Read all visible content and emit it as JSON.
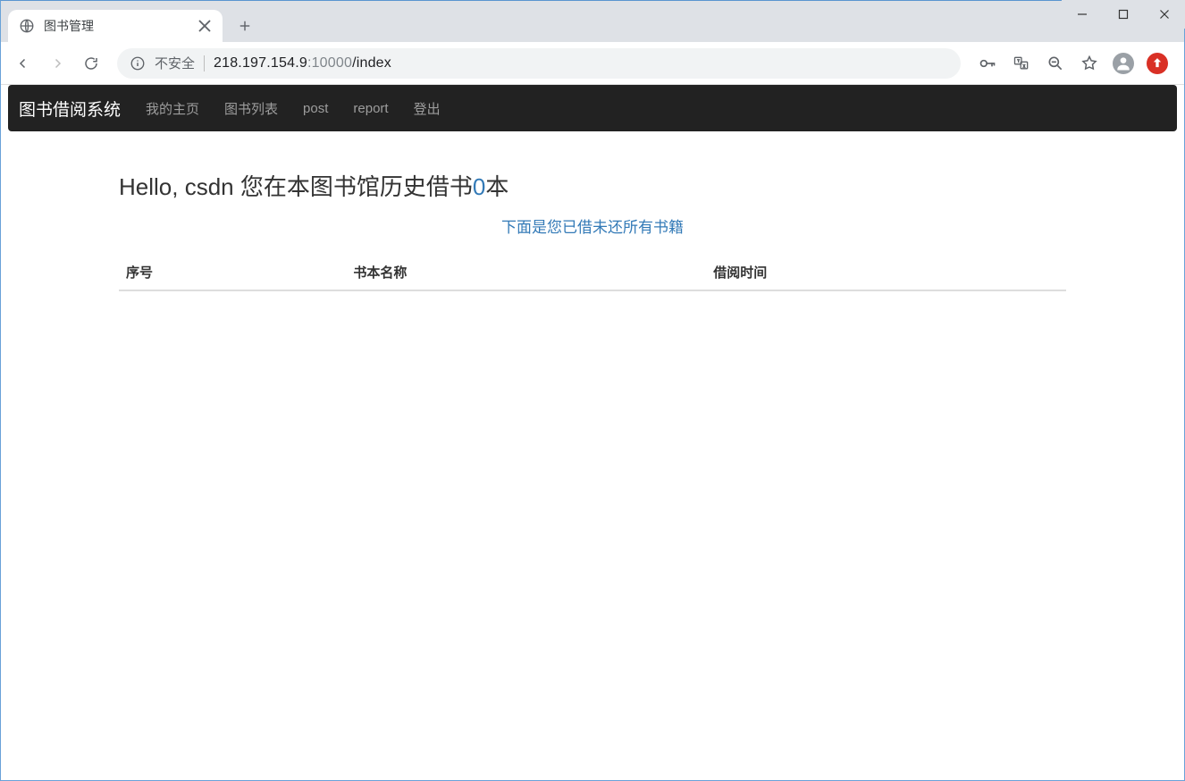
{
  "tab": {
    "title": "图书管理"
  },
  "address": {
    "insecure_label": "不安全",
    "host": "218.197.154.9",
    "port": ":10000",
    "path": "/index"
  },
  "navbar": {
    "brand": "图书借阅系统",
    "links": [
      "我的主页",
      "图书列表",
      "post",
      "report",
      "登出"
    ]
  },
  "page": {
    "greeting_prefix": "Hello, csdn 您在本图书馆历史借书",
    "borrow_count": "0",
    "greeting_suffix": "本",
    "subtitle": "下面是您已借未还所有书籍",
    "table_headers": [
      "序号",
      "书本名称",
      "借阅时间"
    ],
    "rows": []
  }
}
